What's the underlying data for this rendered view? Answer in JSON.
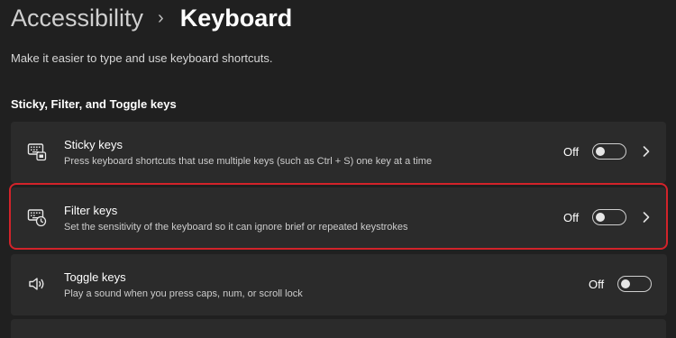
{
  "breadcrumb": {
    "parent": "Accessibility",
    "separator": "›",
    "current": "Keyboard"
  },
  "description": "Make it easier to type and use keyboard shortcuts.",
  "section": {
    "title": "Sticky, Filter, and Toggle keys"
  },
  "settings": [
    {
      "id": "sticky",
      "icon": "sticky-keys-icon",
      "title": "Sticky keys",
      "subtitle": "Press keyboard shortcuts that use multiple keys (such as Ctrl + S) one key at a time",
      "state": "Off",
      "has_chevron": true
    },
    {
      "id": "filter",
      "icon": "filter-keys-icon",
      "title": "Filter keys",
      "subtitle": "Set the sensitivity of the keyboard so it can ignore brief or repeated keystrokes",
      "state": "Off",
      "has_chevron": true,
      "highlighted": true
    },
    {
      "id": "toggle",
      "icon": "speaker-icon",
      "title": "Toggle keys",
      "subtitle": "Play a sound when you press caps, num, or scroll lock",
      "state": "Off",
      "has_chevron": false
    }
  ],
  "colors": {
    "background": "#202020",
    "card": "#2b2b2b",
    "highlight": "#d2232a"
  }
}
